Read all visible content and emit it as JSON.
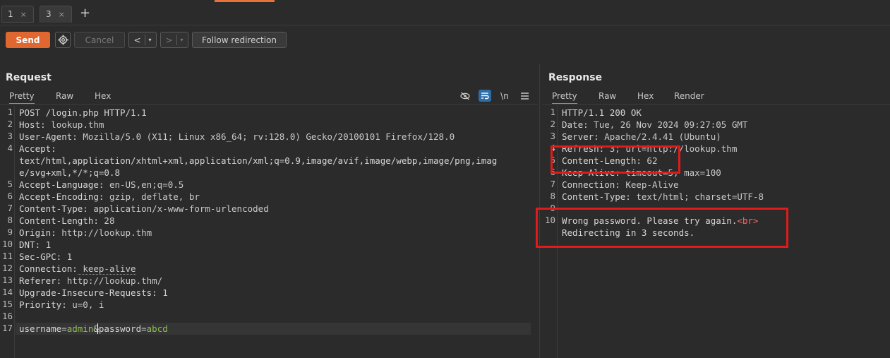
{
  "tabs": [
    {
      "label": "1",
      "close": "×"
    },
    {
      "label": "3",
      "close": "×"
    }
  ],
  "new_tab": "+",
  "toolbar": {
    "send": "Send",
    "cancel": "Cancel",
    "back": "<",
    "forward": ">",
    "dropdown": "▾",
    "follow": "Follow redirection"
  },
  "request": {
    "title": "Request",
    "tabs": [
      "Pretty",
      "Raw",
      "Hex"
    ],
    "icons": [
      "eye-off-icon",
      "wrap-icon",
      "newline-icon",
      "menu-icon"
    ],
    "newline_label": "\\n",
    "lines": [
      {
        "n": "1",
        "text": "POST /login.php HTTP/1.1"
      },
      {
        "n": "2",
        "k": "Host:",
        "v": " lookup.thm"
      },
      {
        "n": "3",
        "k": "User-Agent:",
        "v": " Mozilla/5.0 (X11; Linux x86_64; rv:128.0) Gecko/20100101 Firefox/128.0"
      },
      {
        "n": "4",
        "k": "Accept:",
        "v": ""
      },
      {
        "n": "",
        "text": "text/html,application/xhtml+xml,application/xml;q=0.9,image/avif,image/webp,image/png,imag"
      },
      {
        "n": "",
        "text": "e/svg+xml,*/*;q=0.8"
      },
      {
        "n": "5",
        "k": "Accept-Language:",
        "v": " en-US,en;q=0.5"
      },
      {
        "n": "6",
        "k": "Accept-Encoding:",
        "v": " gzip, deflate, br"
      },
      {
        "n": "7",
        "k": "Content-Type:",
        "v": " application/x-www-form-urlencoded"
      },
      {
        "n": "8",
        "k": "Content-Length:",
        "v": " 28"
      },
      {
        "n": "9",
        "k": "Origin:",
        "v": " http://lookup.thm"
      },
      {
        "n": "10",
        "k": "DNT:",
        "v": " 1"
      },
      {
        "n": "11",
        "k": "Sec-GPC:",
        "v": " 1"
      },
      {
        "n": "12",
        "k": "Connection:",
        "v": " keep-alive"
      },
      {
        "n": "13",
        "k": "Referer:",
        "v": " http://lookup.thm/"
      },
      {
        "n": "14",
        "k": "Upgrade-Insecure-Requests:",
        "v": " 1"
      },
      {
        "n": "15",
        "k": "Priority:",
        "v": " u=0, i"
      },
      {
        "n": "16",
        "text": ""
      }
    ],
    "body_line": {
      "n": "17",
      "p1": "username=",
      "v1": "admin",
      "amp": "&",
      "p2": "password=",
      "v2": "abcd"
    }
  },
  "response": {
    "title": "Response",
    "tabs": [
      "Pretty",
      "Raw",
      "Hex",
      "Render"
    ],
    "lines": [
      {
        "n": "1",
        "text": "HTTP/1.1 200 OK"
      },
      {
        "n": "2",
        "k": "Date:",
        "v": " Tue, 26 Nov 2024 09:27:05 GMT"
      },
      {
        "n": "3",
        "k": "Server:",
        "v": " Apache/2.4.41 (Ubuntu)"
      },
      {
        "n": "4",
        "k": "Refresh:",
        "v": " 3; url=http://lookup.thm"
      },
      {
        "n": "5",
        "k": "Content-Length:",
        "v": " 62"
      },
      {
        "n": "6",
        "k": "Keep-Alive:",
        "v": " timeout=5, max=100"
      },
      {
        "n": "7",
        "k": "Connection:",
        "v": " Keep-Alive"
      },
      {
        "n": "8",
        "k": "Content-Type:",
        "v": " text/html; charset=UTF-8"
      },
      {
        "n": "9",
        "text": ""
      }
    ],
    "body": {
      "n": "10",
      "line1": "Wrong password. Please try again.",
      "tag": "<br>",
      "line2": "Redirecting in 3 seconds."
    }
  },
  "colors": {
    "accent": "#e8733a",
    "send": "#e0672f",
    "annotation": "#e01b1b",
    "param_value": "#8fbf4f",
    "tag": "#f26a6a"
  }
}
